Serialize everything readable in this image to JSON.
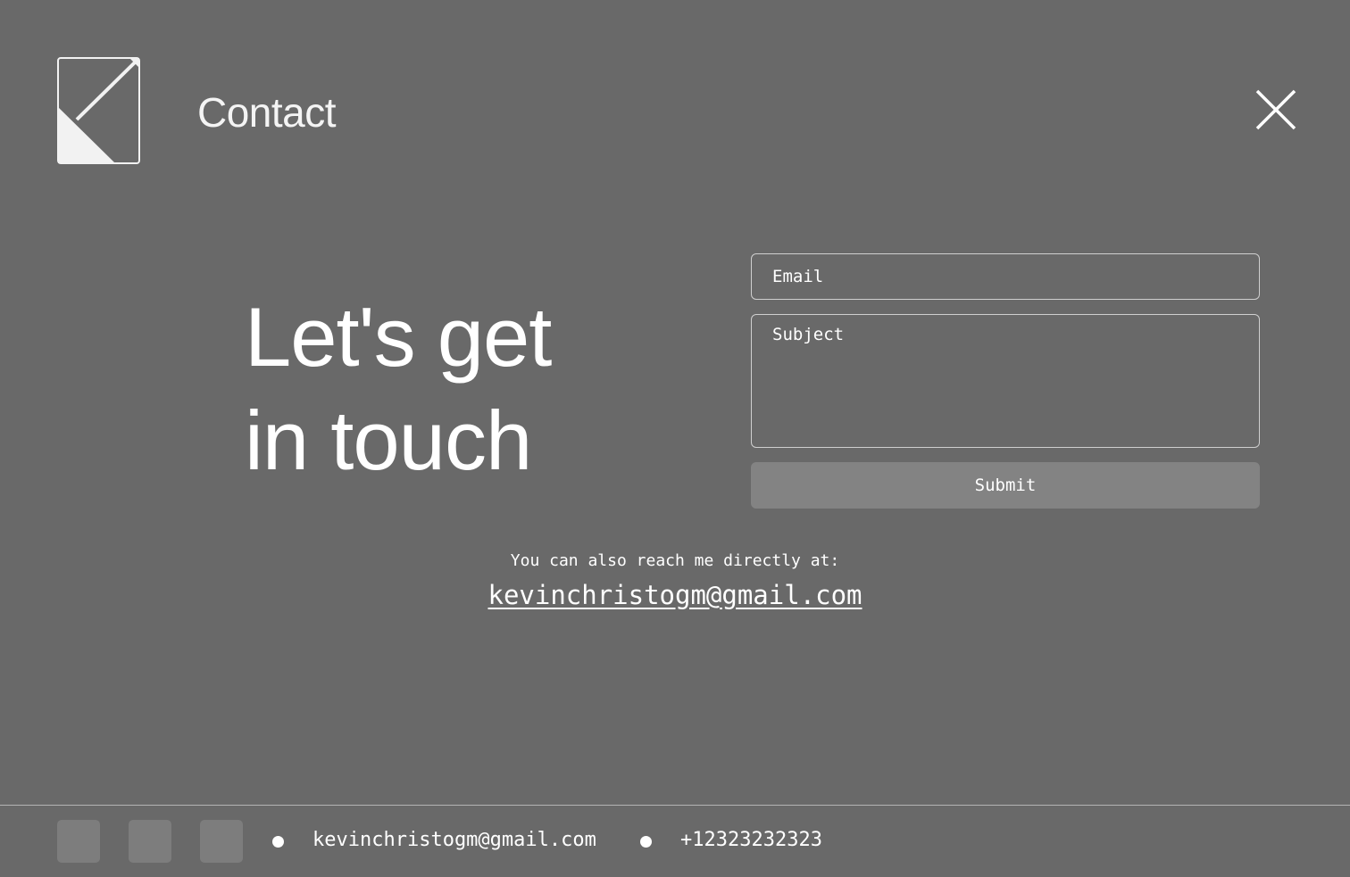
{
  "header": {
    "title": "Contact",
    "logo_icon": "brand-logo-icon",
    "close_icon": "close-icon"
  },
  "hero": {
    "line1": "Let's get",
    "line2": "in touch"
  },
  "form": {
    "email_placeholder": "Email",
    "subject_placeholder": "Subject",
    "submit_label": "Submit"
  },
  "direct": {
    "text": "You can also reach me directly at:",
    "email": "kevinchristogm@gmail.com"
  },
  "footer": {
    "email": "kevinchristogm@gmail.com",
    "phone": "+12323232323"
  },
  "colors": {
    "background": "#696969",
    "button": "#838383",
    "social_tile": "#7d7d7d",
    "text": "#ffffff"
  }
}
